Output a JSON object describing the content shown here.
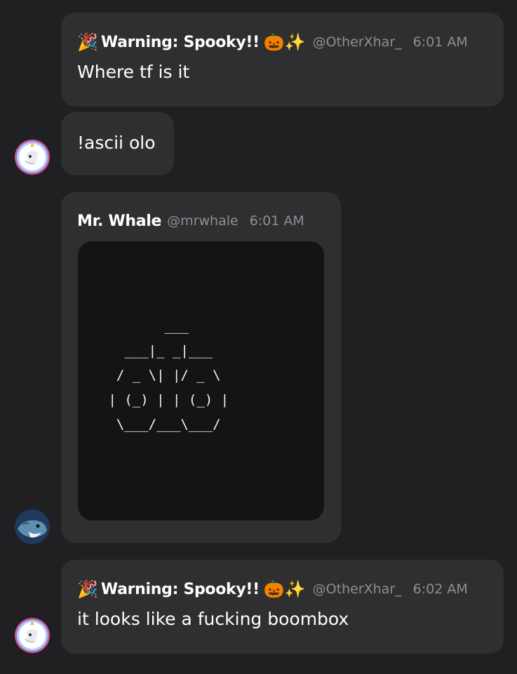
{
  "messages": [
    {
      "display_name": "Warning: Spooky!!",
      "prefix_emoji": "🎉",
      "suffix_emoji": "🎃✨",
      "handle": "@OtherXhar_",
      "time": "6:01 AM",
      "text": "Where tf is it"
    },
    {
      "text": "!ascii olo"
    },
    {
      "display_name": "Mr. Whale",
      "handle": "@mrwhale",
      "time": "6:01 AM",
      "ascii_art": "        ___\n   ___|_ _|___\n  / _ \\| |/ _ \\\n | (_) | | (_) |\n  \\___/___\\___/"
    },
    {
      "display_name": "Warning: Spooky!!",
      "prefix_emoji": "🎉",
      "suffix_emoji": "🎃✨",
      "handle": "@OtherXhar_",
      "time": "6:02 AM",
      "text": "it looks like a fucking boombox"
    }
  ],
  "colors": {
    "background": "#202022",
    "bubble": "#2f2f31",
    "code_block": "#141414",
    "meta_text": "#8f8f93"
  }
}
